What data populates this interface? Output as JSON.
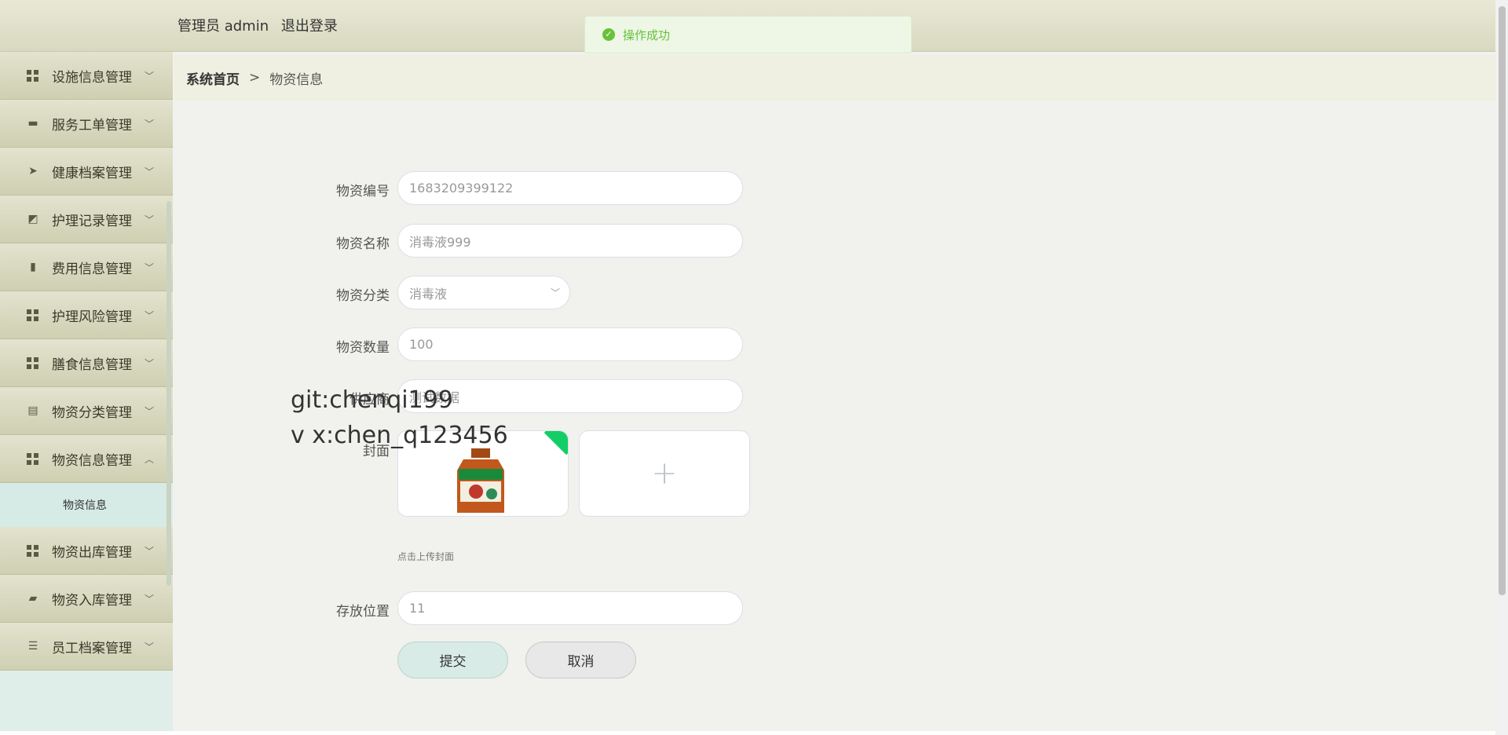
{
  "header": {
    "user_label": "管理员 admin",
    "logout": "退出登录"
  },
  "toast": {
    "message": "操作成功"
  },
  "sidebar": {
    "items": [
      {
        "label": "设施信息管理",
        "icon": "grid-icon"
      },
      {
        "label": "服务工单管理",
        "icon": "monitor-icon"
      },
      {
        "label": "健康档案管理",
        "icon": "paper-plane-icon"
      },
      {
        "label": "护理记录管理",
        "icon": "chart-line-icon"
      },
      {
        "label": "费用信息管理",
        "icon": "book-icon"
      },
      {
        "label": "护理风险管理",
        "icon": "grid-icon"
      },
      {
        "label": "膳食信息管理",
        "icon": "grid-icon"
      },
      {
        "label": "物资分类管理",
        "icon": "clipboard-icon"
      },
      {
        "label": "物资信息管理",
        "icon": "grid-icon",
        "expanded": true
      },
      {
        "label": "物资出库管理",
        "icon": "grid-icon"
      },
      {
        "label": "物资入库管理",
        "icon": "briefcase-icon"
      },
      {
        "label": "员工档案管理",
        "icon": "sliders-icon"
      }
    ],
    "sub_item": "物资信息"
  },
  "breadcrumb": {
    "home": "系统首页",
    "separator": ">",
    "current": "物资信息"
  },
  "form": {
    "code_label": "物资编号",
    "code_value": "1683209399122",
    "name_label": "物资名称",
    "name_value": "消毒液999",
    "category_label": "物资分类",
    "category_value": "消毒液",
    "qty_label": "物资数量",
    "qty_value": "100",
    "supplier_label": "供应商",
    "supplier_value": "测试数据",
    "cover_label": "封面",
    "upload_tip": "点击上传封面",
    "location_label": "存放位置",
    "location_value": "11",
    "submit": "提交",
    "cancel": "取消"
  },
  "watermark": {
    "line1": "git:chenqi199",
    "line2": "v x:chen_q123456"
  }
}
